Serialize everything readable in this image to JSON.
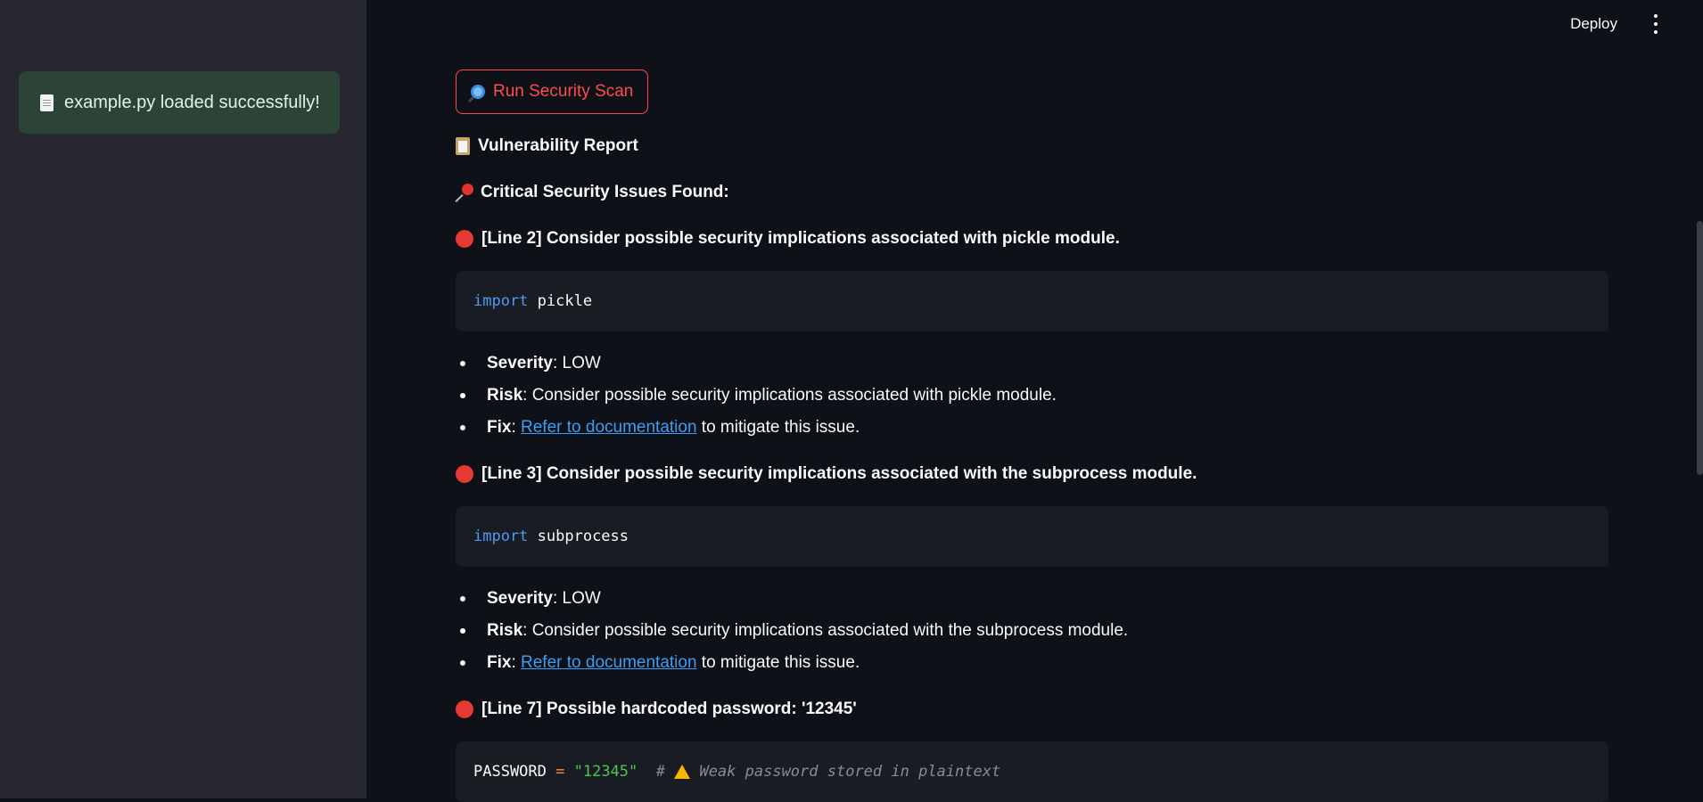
{
  "sidebar": {
    "toast": {
      "icon": "document-icon",
      "text": "example.py loaded successfully!"
    }
  },
  "header": {
    "deploy_label": "Deploy",
    "menu_icon": "more-vertical-icon"
  },
  "main": {
    "scan_button": {
      "icon": "magnifier-icon",
      "label": "Run Security Scan"
    },
    "report_title": {
      "icon": "clipboard-icon",
      "text": "Vulnerability Report"
    },
    "issues_heading": {
      "icon": "pushpin-icon",
      "text": "Critical Security Issues Found:"
    },
    "issues": [
      {
        "icon": "red-circle-icon",
        "title": "[Line 2] Consider possible security implications associated with pickle module.",
        "code": {
          "keyword": "import",
          "rest": " pickle"
        },
        "severity_label": "Severity",
        "severity_value": ": LOW",
        "risk_label": "Risk",
        "risk_value": ": Consider possible security implications associated with pickle module.",
        "fix_label": "Fix",
        "fix_sep": ": ",
        "fix_link": "Refer to documentation",
        "fix_suffix": " to mitigate this issue."
      },
      {
        "icon": "red-circle-icon",
        "title": "[Line 3] Consider possible security implications associated with the subprocess module.",
        "code": {
          "keyword": "import",
          "rest": " subprocess"
        },
        "severity_label": "Severity",
        "severity_value": ": LOW",
        "risk_label": "Risk",
        "risk_value": ": Consider possible security implications associated with the subprocess module.",
        "fix_label": "Fix",
        "fix_sep": ": ",
        "fix_link": "Refer to documentation",
        "fix_suffix": " to mitigate this issue."
      },
      {
        "icon": "red-circle-icon",
        "title": "[Line 7] Possible hardcoded password: '12345'",
        "code": {
          "name": "PASSWORD ",
          "operator": "=",
          "string": " \"12345\"",
          "comment_prefix": "  # ",
          "comment_icon": "warning-icon",
          "comment_text": " Weak password stored in plaintext"
        }
      }
    ]
  },
  "colors": {
    "background": "#0e1117",
    "sidebar": "#262730",
    "accent": "#ff4b4b",
    "success_bg": "#2b4435",
    "link": "#3d9df5",
    "keyword": "#4e9af5"
  }
}
